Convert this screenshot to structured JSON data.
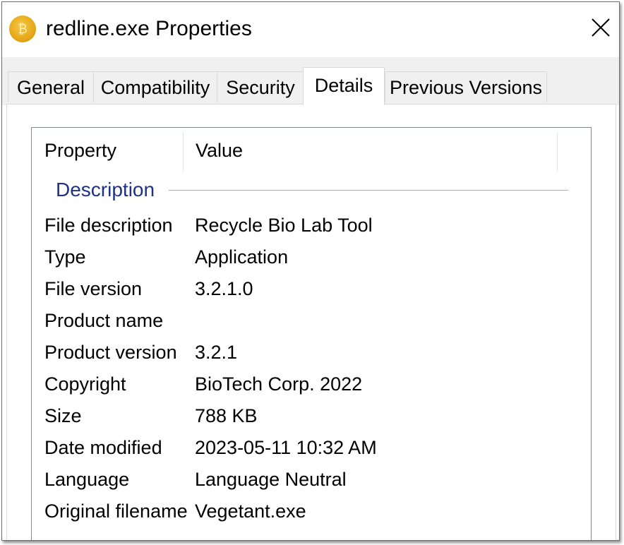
{
  "window": {
    "title": "redline.exe Properties",
    "icon": "coin-app-icon",
    "close_icon": "close-icon"
  },
  "tabs": [
    {
      "label": "General",
      "active": false
    },
    {
      "label": "Compatibility",
      "active": false
    },
    {
      "label": "Security",
      "active": false
    },
    {
      "label": "Details",
      "active": true
    },
    {
      "label": "Previous Versions",
      "active": false
    }
  ],
  "details": {
    "columns": {
      "property": "Property",
      "value": "Value"
    },
    "group": "Description",
    "rows": [
      {
        "property": "File description",
        "value": "Recycle Bio Lab Tool"
      },
      {
        "property": "Type",
        "value": "Application"
      },
      {
        "property": "File version",
        "value": "3.2.1.0"
      },
      {
        "property": "Product name",
        "value": ""
      },
      {
        "property": "Product version",
        "value": "3.2.1"
      },
      {
        "property": "Copyright",
        "value": "BioTech Corp. 2022"
      },
      {
        "property": "Size",
        "value": "788 KB"
      },
      {
        "property": "Date modified",
        "value": "2023-05-11 10:32 AM"
      },
      {
        "property": "Language",
        "value": "Language Neutral"
      },
      {
        "property": "Original filename",
        "value": "Vegetant.exe"
      }
    ]
  },
  "colors": {
    "group_label": "#1e3287",
    "group_line": "#9aaee2",
    "tab_background": "#f0f0f0",
    "listview_border": "#828790"
  }
}
